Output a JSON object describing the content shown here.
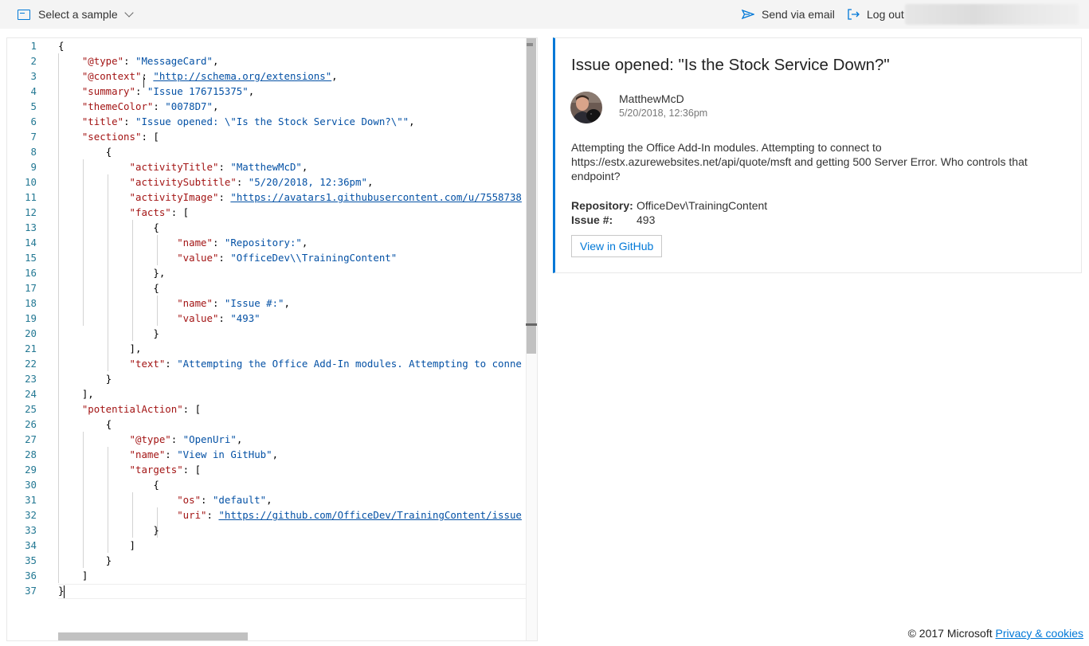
{
  "topbar": {
    "select_sample_label": "Select a sample",
    "send_email_label": "Send via email",
    "logout_label": "Log out"
  },
  "editor": {
    "line_numbers": [
      "1",
      "2",
      "3",
      "4",
      "5",
      "6",
      "7",
      "8",
      "9",
      "10",
      "11",
      "12",
      "13",
      "14",
      "15",
      "16",
      "17",
      "18",
      "19",
      "20",
      "21",
      "22",
      "23",
      "24",
      "25",
      "26",
      "27",
      "28",
      "29",
      "30",
      "31",
      "32",
      "33",
      "34",
      "35",
      "36",
      "37"
    ],
    "lines": [
      [
        {
          "t": "{",
          "c": "p"
        }
      ],
      [
        {
          "t": "    "
        },
        {
          "t": "\"@type\"",
          "c": "k"
        },
        {
          "t": ": ",
          "c": "p"
        },
        {
          "t": "\"MessageCard\"",
          "c": "s"
        },
        {
          "t": ",",
          "c": "p"
        }
      ],
      [
        {
          "t": "    "
        },
        {
          "t": "\"@context\"",
          "c": "k"
        },
        {
          "t": ": ",
          "c": "p"
        },
        {
          "t": "\"http://schema.org/extensions\"",
          "c": "s lnk"
        },
        {
          "t": ",",
          "c": "p"
        }
      ],
      [
        {
          "t": "    "
        },
        {
          "t": "\"summary\"",
          "c": "k"
        },
        {
          "t": ": ",
          "c": "p"
        },
        {
          "t": "\"Issue 176715375\"",
          "c": "s"
        },
        {
          "t": ",",
          "c": "p"
        }
      ],
      [
        {
          "t": "    "
        },
        {
          "t": "\"themeColor\"",
          "c": "k"
        },
        {
          "t": ": ",
          "c": "p"
        },
        {
          "t": "\"0078D7\"",
          "c": "s"
        },
        {
          "t": ",",
          "c": "p"
        }
      ],
      [
        {
          "t": "    "
        },
        {
          "t": "\"title\"",
          "c": "k"
        },
        {
          "t": ": ",
          "c": "p"
        },
        {
          "t": "\"Issue opened: \\\"Is the Stock Service Down?\\\"\"",
          "c": "s"
        },
        {
          "t": ",",
          "c": "p"
        }
      ],
      [
        {
          "t": "    "
        },
        {
          "t": "\"sections\"",
          "c": "k"
        },
        {
          "t": ": [",
          "c": "p"
        }
      ],
      [
        {
          "t": "        "
        },
        {
          "t": "{",
          "c": "p"
        }
      ],
      [
        {
          "t": "            "
        },
        {
          "t": "\"activityTitle\"",
          "c": "k"
        },
        {
          "t": ": ",
          "c": "p"
        },
        {
          "t": "\"MatthewMcD\"",
          "c": "s"
        },
        {
          "t": ",",
          "c": "p"
        }
      ],
      [
        {
          "t": "            "
        },
        {
          "t": "\"activitySubtitle\"",
          "c": "k"
        },
        {
          "t": ": ",
          "c": "p"
        },
        {
          "t": "\"5/20/2018, 12:36pm\"",
          "c": "s"
        },
        {
          "t": ",",
          "c": "p"
        }
      ],
      [
        {
          "t": "            "
        },
        {
          "t": "\"activityImage\"",
          "c": "k"
        },
        {
          "t": ": ",
          "c": "p"
        },
        {
          "t": "\"https://avatars1.githubusercontent.com/u/7558738",
          "c": "s lnk"
        }
      ],
      [
        {
          "t": "            "
        },
        {
          "t": "\"facts\"",
          "c": "k"
        },
        {
          "t": ": [",
          "c": "p"
        }
      ],
      [
        {
          "t": "                "
        },
        {
          "t": "{",
          "c": "p"
        }
      ],
      [
        {
          "t": "                    "
        },
        {
          "t": "\"name\"",
          "c": "k"
        },
        {
          "t": ": ",
          "c": "p"
        },
        {
          "t": "\"Repository:\"",
          "c": "s"
        },
        {
          "t": ",",
          "c": "p"
        }
      ],
      [
        {
          "t": "                    "
        },
        {
          "t": "\"value\"",
          "c": "k"
        },
        {
          "t": ": ",
          "c": "p"
        },
        {
          "t": "\"OfficeDev\\\\TrainingContent\"",
          "c": "s"
        }
      ],
      [
        {
          "t": "                "
        },
        {
          "t": "},",
          "c": "p"
        }
      ],
      [
        {
          "t": "                "
        },
        {
          "t": "{",
          "c": "p"
        }
      ],
      [
        {
          "t": "                    "
        },
        {
          "t": "\"name\"",
          "c": "k"
        },
        {
          "t": ": ",
          "c": "p"
        },
        {
          "t": "\"Issue #:\"",
          "c": "s"
        },
        {
          "t": ",",
          "c": "p"
        }
      ],
      [
        {
          "t": "                    "
        },
        {
          "t": "\"value\"",
          "c": "k"
        },
        {
          "t": ": ",
          "c": "p"
        },
        {
          "t": "\"493\"",
          "c": "s"
        }
      ],
      [
        {
          "t": "                "
        },
        {
          "t": "}",
          "c": "p"
        }
      ],
      [
        {
          "t": "            "
        },
        {
          "t": "],",
          "c": "p"
        }
      ],
      [
        {
          "t": "            "
        },
        {
          "t": "\"text\"",
          "c": "k"
        },
        {
          "t": ": ",
          "c": "p"
        },
        {
          "t": "\"Attempting the Office Add-In modules. Attempting to conne",
          "c": "s"
        }
      ],
      [
        {
          "t": "        "
        },
        {
          "t": "}",
          "c": "p"
        }
      ],
      [
        {
          "t": "    "
        },
        {
          "t": "],",
          "c": "p"
        }
      ],
      [
        {
          "t": "    "
        },
        {
          "t": "\"potentialAction\"",
          "c": "k"
        },
        {
          "t": ": [",
          "c": "p"
        }
      ],
      [
        {
          "t": "        "
        },
        {
          "t": "{",
          "c": "p"
        }
      ],
      [
        {
          "t": "            "
        },
        {
          "t": "\"@type\"",
          "c": "k"
        },
        {
          "t": ": ",
          "c": "p"
        },
        {
          "t": "\"OpenUri\"",
          "c": "s"
        },
        {
          "t": ",",
          "c": "p"
        }
      ],
      [
        {
          "t": "            "
        },
        {
          "t": "\"name\"",
          "c": "k"
        },
        {
          "t": ": ",
          "c": "p"
        },
        {
          "t": "\"View in GitHub\"",
          "c": "s"
        },
        {
          "t": ",",
          "c": "p"
        }
      ],
      [
        {
          "t": "            "
        },
        {
          "t": "\"targets\"",
          "c": "k"
        },
        {
          "t": ": [",
          "c": "p"
        }
      ],
      [
        {
          "t": "                "
        },
        {
          "t": "{",
          "c": "p"
        }
      ],
      [
        {
          "t": "                    "
        },
        {
          "t": "\"os\"",
          "c": "k"
        },
        {
          "t": ": ",
          "c": "p"
        },
        {
          "t": "\"default\"",
          "c": "s"
        },
        {
          "t": ",",
          "c": "p"
        }
      ],
      [
        {
          "t": "                    "
        },
        {
          "t": "\"uri\"",
          "c": "k"
        },
        {
          "t": ": ",
          "c": "p"
        },
        {
          "t": "\"https://github.com/OfficeDev/TrainingContent/issue",
          "c": "s lnk"
        }
      ],
      [
        {
          "t": "                "
        },
        {
          "t": "}",
          "c": "p"
        }
      ],
      [
        {
          "t": "            "
        },
        {
          "t": "]",
          "c": "p"
        }
      ],
      [
        {
          "t": "        "
        },
        {
          "t": "}",
          "c": "p"
        }
      ],
      [
        {
          "t": "    "
        },
        {
          "t": "]",
          "c": "p"
        }
      ],
      [
        {
          "t": "}",
          "c": "p"
        }
      ]
    ]
  },
  "card": {
    "theme_color": "#0078D7",
    "title": "Issue opened: \"Is the Stock Service Down?\"",
    "activity_title": "MatthewMcD",
    "activity_subtitle": "5/20/2018, 12:36pm",
    "text": "Attempting the Office Add-In modules. Attempting to connect to https://estx.azurewebsites.net/api/quote/msft and getting 500 Server Error. Who controls that endpoint?",
    "facts": [
      {
        "name": "Repository:",
        "value": "OfficeDev\\TrainingContent"
      },
      {
        "name": "Issue #:",
        "value": "493"
      }
    ],
    "action_label": "View in GitHub"
  },
  "footer": {
    "copyright": "© 2017 Microsoft",
    "privacy_link": "Privacy & cookies"
  }
}
